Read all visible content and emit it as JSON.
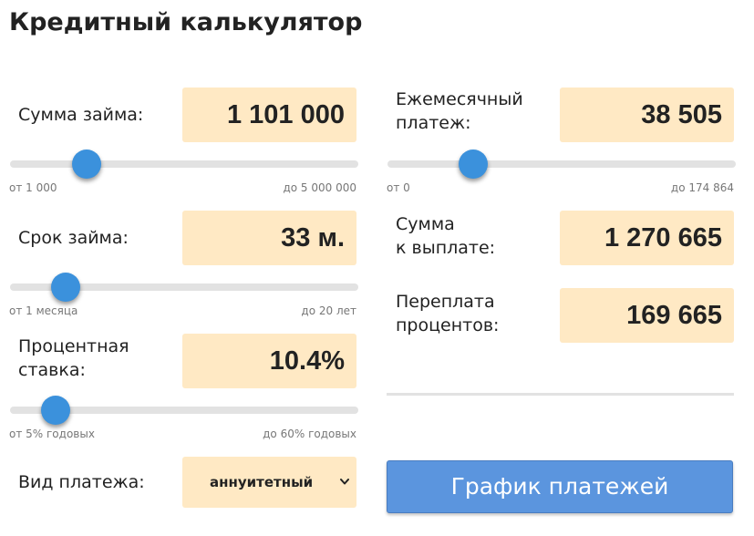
{
  "title": "Кредитный калькулятор",
  "loan_amount": {
    "label": "Сумма займа:",
    "value": "1 101 000",
    "min_label": "от 1 000",
    "max_label": "до 5 000 000",
    "slider_fraction": 0.22
  },
  "loan_term": {
    "label": "Срок займа:",
    "value": "33 м.",
    "min_label": "от 1 месяца",
    "max_label": "до 20 лет",
    "slider_fraction": 0.16
  },
  "interest_rate": {
    "label_line1": "Процентная",
    "label_line2": "ставка:",
    "value": "10.4%",
    "min_label": "от 5% годовых",
    "max_label": "до 60% годовых",
    "slider_fraction": 0.13
  },
  "payment_type": {
    "label": "Вид платежа:",
    "selected": "аннуитетный"
  },
  "monthly_payment": {
    "label_line1": "Ежемесячный",
    "label_line2": "платеж:",
    "value": "38 505",
    "min_label": "от 0",
    "max_label": "до 174 864",
    "slider_fraction": 0.245
  },
  "total_payment": {
    "label_line1": "Сумма",
    "label_line2": "к выплате:",
    "value": "1 270 665"
  },
  "overpayment": {
    "label_line1": "Переплата",
    "label_line2": "процентов:",
    "value": "169 665"
  },
  "schedule_button": {
    "label": "График платежей"
  },
  "colors": {
    "value_box": "#ffe9c4",
    "slider_thumb": "#3b91dc",
    "button": "#5b95de"
  }
}
